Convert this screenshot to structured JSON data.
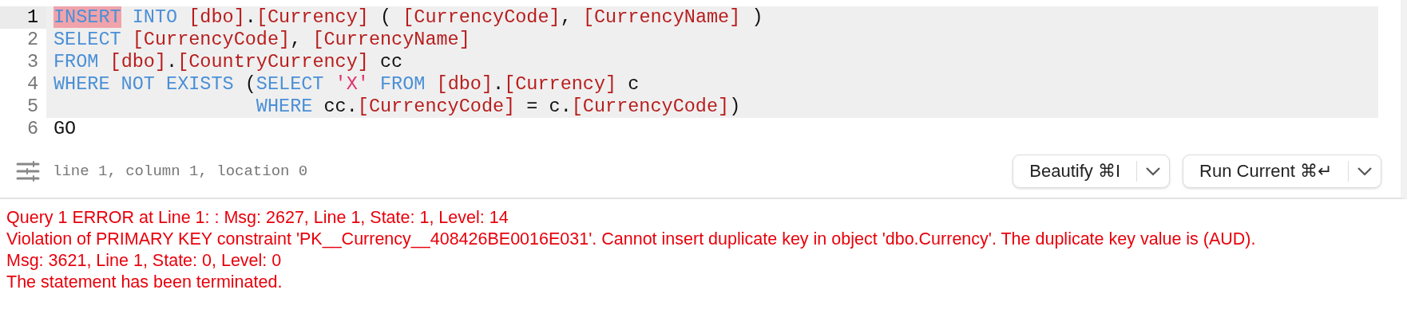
{
  "editor": {
    "lines": [
      {
        "number": "1",
        "current": true,
        "highlighted": true,
        "tokens": [
          {
            "text": "INSERT",
            "kind": "keyword",
            "selected": true
          },
          {
            "text": " INTO",
            "kind": "keyword",
            "selected": false
          },
          {
            "text": " [dbo]",
            "kind": "identifier",
            "selected": false
          },
          {
            "text": ".",
            "kind": "plain",
            "selected": false
          },
          {
            "text": "[Currency]",
            "kind": "identifier",
            "selected": false
          },
          {
            "text": " ( ",
            "kind": "plain",
            "selected": false
          },
          {
            "text": "[CurrencyCode]",
            "kind": "identifier",
            "selected": false
          },
          {
            "text": ", ",
            "kind": "plain",
            "selected": false
          },
          {
            "text": "[CurrencyName]",
            "kind": "identifier",
            "selected": false
          },
          {
            "text": " )",
            "kind": "plain",
            "selected": false
          }
        ]
      },
      {
        "number": "2",
        "current": false,
        "highlighted": true,
        "tokens": [
          {
            "text": "SELECT",
            "kind": "keyword",
            "selected": false
          },
          {
            "text": " [CurrencyCode]",
            "kind": "identifier",
            "selected": false
          },
          {
            "text": ", ",
            "kind": "plain",
            "selected": false
          },
          {
            "text": "[CurrencyName]",
            "kind": "identifier",
            "selected": false
          }
        ]
      },
      {
        "number": "3",
        "current": false,
        "highlighted": true,
        "tokens": [
          {
            "text": "FROM",
            "kind": "keyword",
            "selected": false
          },
          {
            "text": " [dbo]",
            "kind": "identifier",
            "selected": false
          },
          {
            "text": ".",
            "kind": "plain",
            "selected": false
          },
          {
            "text": "[CountryCurrency]",
            "kind": "identifier",
            "selected": false
          },
          {
            "text": " cc",
            "kind": "plain",
            "selected": false
          }
        ]
      },
      {
        "number": "4",
        "current": false,
        "highlighted": true,
        "tokens": [
          {
            "text": "WHERE NOT EXISTS",
            "kind": "keyword",
            "selected": false
          },
          {
            "text": " (",
            "kind": "plain",
            "selected": false
          },
          {
            "text": "SELECT",
            "kind": "keyword",
            "selected": false
          },
          {
            "text": " 'X'",
            "kind": "string",
            "selected": false
          },
          {
            "text": " FROM",
            "kind": "keyword",
            "selected": false
          },
          {
            "text": " [dbo]",
            "kind": "identifier",
            "selected": false
          },
          {
            "text": ".",
            "kind": "plain",
            "selected": false
          },
          {
            "text": "[Currency]",
            "kind": "identifier",
            "selected": false
          },
          {
            "text": " c",
            "kind": "plain",
            "selected": false
          }
        ]
      },
      {
        "number": "5",
        "current": false,
        "highlighted": true,
        "tokens": [
          {
            "text": "                  WHERE",
            "kind": "keyword",
            "selected": false
          },
          {
            "text": " cc.",
            "kind": "plain",
            "selected": false
          },
          {
            "text": "[CurrencyCode]",
            "kind": "identifier",
            "selected": false
          },
          {
            "text": " = c.",
            "kind": "plain",
            "selected": false
          },
          {
            "text": "[CurrencyCode]",
            "kind": "identifier",
            "selected": false
          },
          {
            "text": ")",
            "kind": "plain",
            "selected": false
          }
        ]
      },
      {
        "number": "6",
        "current": false,
        "highlighted": false,
        "tokens": [
          {
            "text": "GO",
            "kind": "plain",
            "selected": false
          }
        ]
      }
    ]
  },
  "toolbar": {
    "position": "line 1, column 1, location 0",
    "buttons": [
      {
        "label": "Beautify ⌘I"
      },
      {
        "label": "Run Current ⌘↵"
      }
    ]
  },
  "messages": [
    "Query 1 ERROR at Line 1: : Msg: 2627, Line 1, State: 1, Level: 14",
    "Violation of PRIMARY KEY constraint 'PK__Currency__408426BE0016E031'. Cannot insert duplicate key in object 'dbo.Currency'. The duplicate key value is (AUD).",
    "Msg: 3621, Line 1, State: 0, Level: 0",
    "The statement has been terminated."
  ]
}
